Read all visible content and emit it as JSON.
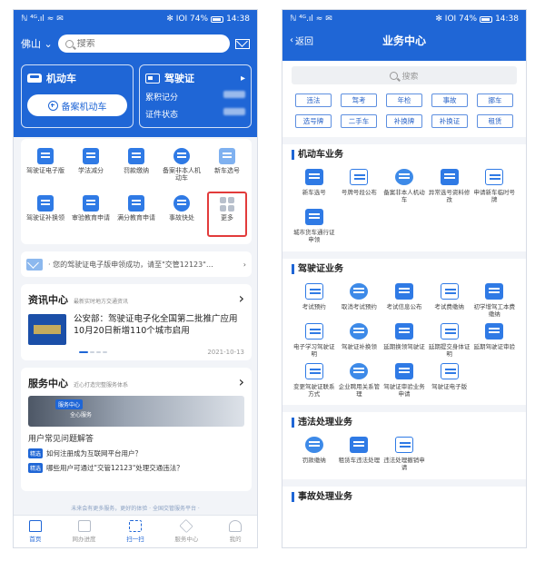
{
  "status_bar": {
    "signal": "ℕ ⁴ᴳ.ıl ≈ ✉",
    "battery_pct": "✻ ⅠOⅠ 74%",
    "time": "14:38"
  },
  "home": {
    "city": "佛山",
    "search_placeholder": "搜索",
    "vehicle_card": {
      "title": "机动车",
      "add_label": "备案机动车"
    },
    "license_card": {
      "title": "驾驶证",
      "points_label": "累积记分",
      "status_label": "证件状态"
    },
    "services": [
      {
        "label": "驾驶证电子版"
      },
      {
        "label": "学法减分"
      },
      {
        "label": "罚款缴纳"
      },
      {
        "label": "备案非本人机动车"
      },
      {
        "label": "新车选号"
      },
      {
        "label": "驾驶证补换领"
      },
      {
        "label": "审验教育申请"
      },
      {
        "label": "满分教育申请"
      },
      {
        "label": "事故快处"
      },
      {
        "label": "更多"
      }
    ],
    "notice": "· 您的驾驶证电子版申领成功，请至\"交管12123\"…",
    "news": {
      "title": "资讯中心",
      "subtitle": "最新实时地方交通资讯",
      "headline": "公安部：驾驶证电子化全国第二批推广应用 10月20日新增110个城市启用",
      "date": "2021-10-13"
    },
    "service_center": {
      "title": "服务中心",
      "subtitle": "近心打造完整服务体系",
      "banner_tag": "服务中心",
      "banner_text": "全心服务",
      "faq_title": "用户常见问题解答",
      "faq_tag": "精选",
      "faqs": [
        "如何注册成为互联网平台用户？",
        "哪些用户可通过\"交管12123\"处理交通违法？"
      ]
    },
    "promo": "未来会有更多服务，更好的体验 · 全国交管服务平台 ·",
    "tabs": [
      {
        "label": "首页"
      },
      {
        "label": "网办进度"
      },
      {
        "label": "扫一扫"
      },
      {
        "label": "服务中心"
      },
      {
        "label": "我的"
      }
    ]
  },
  "business": {
    "back_label": "返回",
    "title": "业务中心",
    "search_placeholder": "搜索",
    "chips": [
      "违法",
      "驾考",
      "年检",
      "事故",
      "挪车",
      "选号牌",
      "二手车",
      "补换牌",
      "补换证",
      "租赁"
    ],
    "categories": [
      {
        "title": "机动车业务",
        "items": [
          "新车选号",
          "号牌号段公布",
          "备案非本人机动车",
          "异常选号资料修改",
          "申请新车临时号牌",
          "城市货车通行证申领"
        ]
      },
      {
        "title": "驾驶证业务",
        "items": [
          "考试预约",
          "取消考试预约",
          "考试信息公布",
          "考试费缴纳",
          "初学增驾工本费缴纳",
          "电子学习驾驶证明",
          "驾驶证补换领",
          "延期换领驾驶证",
          "延期提交身体证明",
          "延期驾驶证审验",
          "变更驾驶证联系方式",
          "企业聘用关系管理",
          "驾驶证审验业务申请",
          "驾驶证电子版"
        ]
      },
      {
        "title": "违法处理业务",
        "items": [
          "罚款缴纳",
          "租赁车违法处理",
          "违法处理撤销申请"
        ]
      },
      {
        "title": "事故处理业务",
        "items": []
      }
    ]
  },
  "colors": {
    "brand_blue": "#1f66d6",
    "highlight_red": "#e23b3b"
  }
}
